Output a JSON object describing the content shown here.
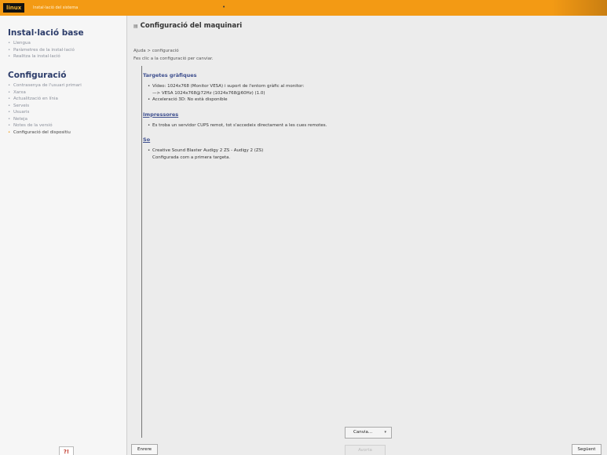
{
  "topbar": {
    "logo": "linux",
    "subtitle": "Instal·lació del sistema",
    "marker": "•"
  },
  "sidebar": {
    "sections": [
      {
        "title": "Instal·lació base",
        "items": [
          {
            "label": "Llengua",
            "active": false
          },
          {
            "label": "Paràmetres de la instal·lació",
            "active": false
          },
          {
            "label": "Realitza la instal·lació",
            "active": false
          }
        ]
      },
      {
        "title": "Configuració",
        "items": [
          {
            "label": "Contrasenya de l'usuari primari",
            "active": false
          },
          {
            "label": "Xarxa",
            "active": false
          },
          {
            "label": "Actualització en línia",
            "active": false
          },
          {
            "label": "Serveis",
            "active": false
          },
          {
            "label": "Usuaris",
            "active": false
          },
          {
            "label": "Neteja",
            "active": false
          },
          {
            "label": "Notes de la versió",
            "active": false
          },
          {
            "label": "Configuració del dispositiu",
            "active": true
          }
        ]
      }
    ],
    "help_label": "?!"
  },
  "main": {
    "title": "Configuració del maquinari",
    "title_icon": "triangle-icon",
    "crumbs": [
      "Ajuda > configuració",
      "Fes clic a la configuració per canviar."
    ],
    "sections": [
      {
        "title": "Targetes gràfiques",
        "link": false,
        "items": [
          {
            "text": "Vídeo: 1024x768 (Monitor VESA) i suport de l'entorn gràfic al monitor:",
            "sub": "—> VESA 1024x768@72Hz (1024x768@60Hz) (1.0)"
          },
          {
            "text": "Acceleració 3D: No està disponible",
            "sub": ""
          }
        ]
      },
      {
        "title": "Impressores",
        "link": true,
        "items": [
          {
            "text": "Es troba un servidor CUPS remot, tot s'accedeix directament a les cues remotes.",
            "sub": ""
          }
        ]
      },
      {
        "title": "So",
        "link": true,
        "items": [
          {
            "text": "Creative Sound Blaster Audigy 2 ZS - Audigy 2 (ZS)",
            "sub": "Configurada com a primera targeta."
          }
        ]
      }
    ],
    "change_button": "Canvia...",
    "change_caret": "▾"
  },
  "footer": {
    "back_label": "Enrere",
    "middle_label": "Avorta",
    "next_label": "Següent"
  }
}
